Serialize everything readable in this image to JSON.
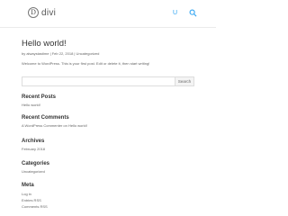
{
  "header": {
    "logo_mark": "D",
    "logo_text": "divi",
    "user_glyph": "U"
  },
  "post": {
    "title": "Hello world!",
    "meta": "by alwaystastime | Feb 22, 2018 | Uncategorized",
    "body": "Welcome to WordPress. This is your first post. Edit or delete it, then start writing!"
  },
  "search": {
    "placeholder": "",
    "button_label": "Search"
  },
  "sidebar": {
    "recent_posts": {
      "title": "Recent Posts",
      "items": [
        "Hello world!"
      ]
    },
    "recent_comments": {
      "title": "Recent Comments",
      "items": [
        "A WordPress Commenter on Hello world!"
      ]
    },
    "archives": {
      "title": "Archives",
      "items": [
        "February 2018"
      ]
    },
    "categories": {
      "title": "Categories",
      "items": [
        "Uncategorized"
      ]
    },
    "meta": {
      "title": "Meta",
      "items": [
        "Log in",
        "Entries RSS",
        "Comments RSS"
      ]
    }
  },
  "colors": {
    "accent": "#2ea3f2",
    "heading": "#333333",
    "text": "#666666"
  }
}
